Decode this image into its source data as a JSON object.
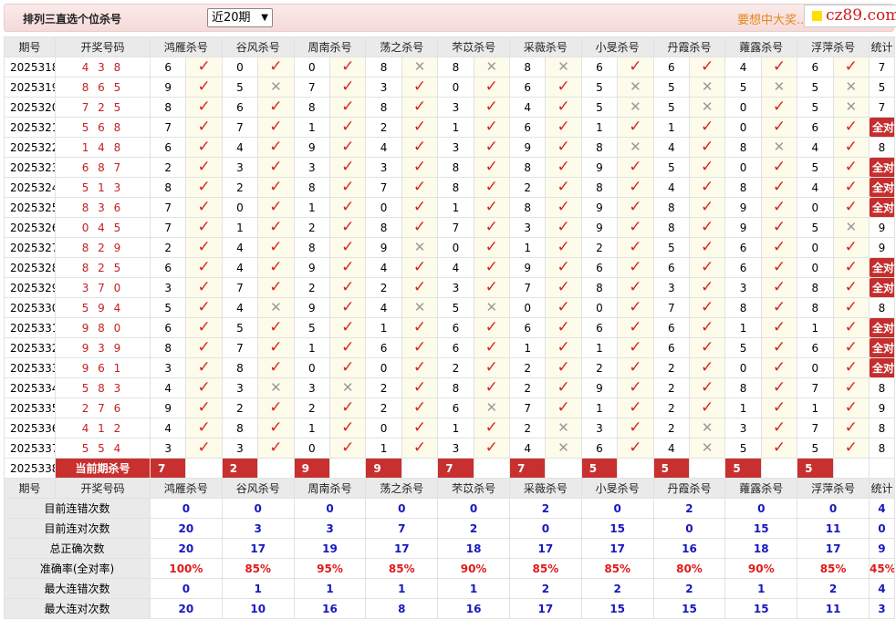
{
  "header": {
    "title": "排列三直选个位杀号",
    "select_value": "近20期",
    "promo": "要想中大奖...",
    "logo_text": "cz89.com"
  },
  "columns": {
    "issue": "期号",
    "winning": "开奖号码",
    "stat": "统计",
    "kill": [
      "鸿雁杀号",
      "谷风杀号",
      "周南杀号",
      "荡之杀号",
      "芣苡杀号",
      "采薇杀号",
      "小旻杀号",
      "丹霞杀号",
      "蕹露杀号",
      "浮萍杀号"
    ]
  },
  "rows": [
    {
      "issue": "2025318",
      "win": "438",
      "picks": [
        "6",
        "0",
        "0",
        "8",
        "8",
        "8",
        "6",
        "6",
        "4",
        "6"
      ],
      "marks": [
        1,
        1,
        1,
        0,
        0,
        0,
        1,
        1,
        1,
        1
      ],
      "stat": "7"
    },
    {
      "issue": "2025319",
      "win": "865",
      "picks": [
        "9",
        "5",
        "7",
        "3",
        "0",
        "6",
        "5",
        "5",
        "5",
        "5"
      ],
      "marks": [
        1,
        0,
        1,
        1,
        1,
        1,
        0,
        0,
        0,
        0
      ],
      "stat": "5"
    },
    {
      "issue": "2025320",
      "win": "725",
      "picks": [
        "8",
        "6",
        "8",
        "8",
        "3",
        "4",
        "5",
        "5",
        "0",
        "5"
      ],
      "marks": [
        1,
        1,
        1,
        1,
        1,
        1,
        0,
        0,
        1,
        0
      ],
      "stat": "7"
    },
    {
      "issue": "2025321",
      "win": "568",
      "picks": [
        "7",
        "7",
        "1",
        "2",
        "1",
        "6",
        "1",
        "1",
        "0",
        "6"
      ],
      "marks": [
        1,
        1,
        1,
        1,
        1,
        1,
        1,
        1,
        1,
        1
      ],
      "stat": "全对"
    },
    {
      "issue": "2025322",
      "win": "148",
      "picks": [
        "6",
        "4",
        "9",
        "4",
        "3",
        "9",
        "8",
        "4",
        "8",
        "4"
      ],
      "marks": [
        1,
        1,
        1,
        1,
        1,
        1,
        0,
        1,
        0,
        1
      ],
      "stat": "8"
    },
    {
      "issue": "2025323",
      "win": "687",
      "picks": [
        "2",
        "3",
        "3",
        "3",
        "8",
        "8",
        "9",
        "5",
        "0",
        "5"
      ],
      "marks": [
        1,
        1,
        1,
        1,
        1,
        1,
        1,
        1,
        1,
        1
      ],
      "stat": "全对"
    },
    {
      "issue": "2025324",
      "win": "513",
      "picks": [
        "8",
        "2",
        "8",
        "7",
        "8",
        "2",
        "8",
        "4",
        "8",
        "4"
      ],
      "marks": [
        1,
        1,
        1,
        1,
        1,
        1,
        1,
        1,
        1,
        1
      ],
      "stat": "全对"
    },
    {
      "issue": "2025325",
      "win": "836",
      "picks": [
        "7",
        "0",
        "1",
        "0",
        "1",
        "8",
        "9",
        "8",
        "9",
        "0"
      ],
      "marks": [
        1,
        1,
        1,
        1,
        1,
        1,
        1,
        1,
        1,
        1
      ],
      "stat": "全对"
    },
    {
      "issue": "2025326",
      "win": "045",
      "picks": [
        "7",
        "1",
        "2",
        "8",
        "7",
        "3",
        "9",
        "8",
        "9",
        "5"
      ],
      "marks": [
        1,
        1,
        1,
        1,
        1,
        1,
        1,
        1,
        1,
        0
      ],
      "stat": "9"
    },
    {
      "issue": "2025327",
      "win": "829",
      "picks": [
        "2",
        "4",
        "8",
        "9",
        "0",
        "1",
        "2",
        "5",
        "6",
        "0"
      ],
      "marks": [
        1,
        1,
        1,
        0,
        1,
        1,
        1,
        1,
        1,
        1
      ],
      "stat": "9"
    },
    {
      "issue": "2025328",
      "win": "825",
      "picks": [
        "6",
        "4",
        "9",
        "4",
        "4",
        "9",
        "6",
        "6",
        "6",
        "0"
      ],
      "marks": [
        1,
        1,
        1,
        1,
        1,
        1,
        1,
        1,
        1,
        1
      ],
      "stat": "全对"
    },
    {
      "issue": "2025329",
      "win": "370",
      "picks": [
        "3",
        "7",
        "2",
        "2",
        "3",
        "7",
        "8",
        "3",
        "3",
        "8"
      ],
      "marks": [
        1,
        1,
        1,
        1,
        1,
        1,
        1,
        1,
        1,
        1
      ],
      "stat": "全对"
    },
    {
      "issue": "2025330",
      "win": "594",
      "picks": [
        "5",
        "4",
        "9",
        "4",
        "5",
        "0",
        "0",
        "7",
        "8",
        "8"
      ],
      "marks": [
        1,
        0,
        1,
        0,
        0,
        1,
        1,
        1,
        1,
        1
      ],
      "stat": "8"
    },
    {
      "issue": "2025331",
      "win": "980",
      "picks": [
        "6",
        "5",
        "5",
        "1",
        "6",
        "6",
        "6",
        "6",
        "1",
        "1"
      ],
      "marks": [
        1,
        1,
        1,
        1,
        1,
        1,
        1,
        1,
        1,
        1
      ],
      "stat": "全对"
    },
    {
      "issue": "2025332",
      "win": "939",
      "picks": [
        "8",
        "7",
        "1",
        "6",
        "6",
        "1",
        "1",
        "6",
        "5",
        "6"
      ],
      "marks": [
        1,
        1,
        1,
        1,
        1,
        1,
        1,
        1,
        1,
        1
      ],
      "stat": "全对"
    },
    {
      "issue": "2025333",
      "win": "961",
      "picks": [
        "3",
        "8",
        "0",
        "0",
        "2",
        "2",
        "2",
        "2",
        "0",
        "0"
      ],
      "marks": [
        1,
        1,
        1,
        1,
        1,
        1,
        1,
        1,
        1,
        1
      ],
      "stat": "全对"
    },
    {
      "issue": "2025334",
      "win": "583",
      "picks": [
        "4",
        "3",
        "3",
        "2",
        "8",
        "2",
        "9",
        "2",
        "8",
        "7"
      ],
      "marks": [
        1,
        0,
        0,
        1,
        1,
        1,
        1,
        1,
        1,
        1
      ],
      "stat": "8"
    },
    {
      "issue": "2025335",
      "win": "276",
      "picks": [
        "9",
        "2",
        "2",
        "2",
        "6",
        "7",
        "1",
        "2",
        "1",
        "1"
      ],
      "marks": [
        1,
        1,
        1,
        1,
        0,
        1,
        1,
        1,
        1,
        1
      ],
      "stat": "9"
    },
    {
      "issue": "2025336",
      "win": "412",
      "picks": [
        "4",
        "8",
        "1",
        "0",
        "1",
        "2",
        "3",
        "2",
        "3",
        "7"
      ],
      "marks": [
        1,
        1,
        1,
        1,
        1,
        0,
        1,
        0,
        1,
        1
      ],
      "stat": "8"
    },
    {
      "issue": "2025337",
      "win": "554",
      "picks": [
        "3",
        "3",
        "0",
        "1",
        "3",
        "4",
        "6",
        "4",
        "5",
        "5"
      ],
      "marks": [
        1,
        1,
        1,
        1,
        1,
        0,
        1,
        0,
        1,
        1
      ],
      "stat": "8"
    }
  ],
  "current": {
    "issue": "2025338",
    "label": "当前期杀号",
    "picks": [
      "7",
      "2",
      "9",
      "9",
      "7",
      "7",
      "5",
      "5",
      "5",
      "5"
    ]
  },
  "stats": [
    {
      "label": "目前连错次数",
      "color": "blue",
      "values": [
        "0",
        "0",
        "0",
        "0",
        "0",
        "2",
        "0",
        "2",
        "0",
        "0"
      ],
      "stat": "4"
    },
    {
      "label": "目前连对次数",
      "color": "blue",
      "values": [
        "20",
        "3",
        "3",
        "7",
        "2",
        "0",
        "15",
        "0",
        "15",
        "11"
      ],
      "stat": "0"
    },
    {
      "label": "总正确次数",
      "color": "blue",
      "values": [
        "20",
        "17",
        "19",
        "17",
        "18",
        "17",
        "17",
        "16",
        "18",
        "17"
      ],
      "stat": "9"
    },
    {
      "label": "准确率(全对率)",
      "color": "red",
      "values": [
        "100%",
        "85%",
        "95%",
        "85%",
        "90%",
        "85%",
        "85%",
        "80%",
        "90%",
        "85%"
      ],
      "stat": "45%"
    },
    {
      "label": "最大连错次数",
      "color": "blue",
      "values": [
        "0",
        "1",
        "1",
        "1",
        "1",
        "2",
        "2",
        "2",
        "1",
        "2"
      ],
      "stat": "4"
    },
    {
      "label": "最大连对次数",
      "color": "blue",
      "values": [
        "20",
        "10",
        "16",
        "8",
        "16",
        "17",
        "15",
        "15",
        "15",
        "11"
      ],
      "stat": "3"
    }
  ],
  "icons": {
    "ok": "check-icon",
    "no": "cross-icon"
  }
}
